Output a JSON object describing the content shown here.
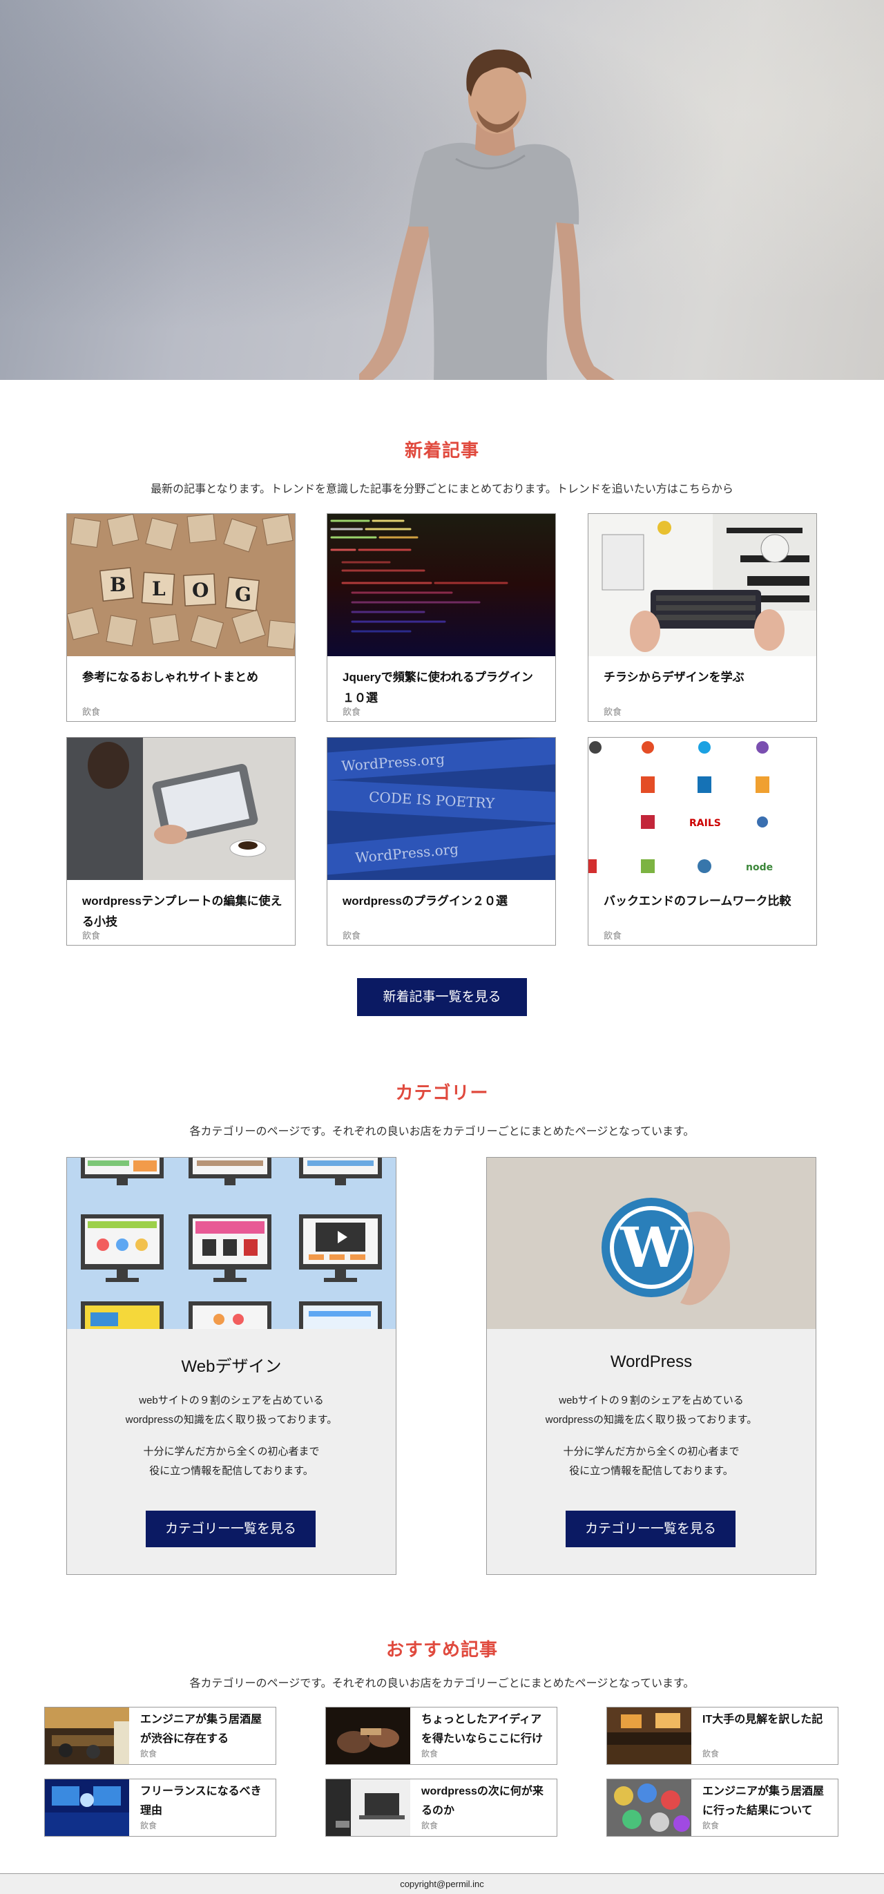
{
  "new_articles": {
    "title": "新着記事",
    "description": "最新の記事となります。トレンドを意識した記事を分野ごとにまとめております。トレンドを追いたい方はこちらから",
    "items": [
      {
        "title": "参考になるおしゃれサイトまとめ",
        "category": "飲食",
        "image": "blog-scrabble-tiles"
      },
      {
        "title": "Jqueryで頻繁に使われるプラグイン１０選",
        "category": "飲食",
        "image": "code-screen"
      },
      {
        "title": "チラシからデザインを学ぶ",
        "category": "飲食",
        "image": "keyboard-desk"
      },
      {
        "title": "wordpressテンプレートの編集に使える小技",
        "category": "飲食",
        "image": "tablet-coffee"
      },
      {
        "title": "wordpressのプラグイン２０選",
        "category": "飲食",
        "image": "wordpress-lanyard"
      },
      {
        "title": "バックエンドのフレームワーク比較",
        "category": "飲食",
        "image": "tech-logos"
      }
    ],
    "button_label": "新着記事一覧を見る"
  },
  "categories": {
    "title": "カテゴリー",
    "description": "各カテゴリーのページです。それぞれの良いお店をカテゴリーごとにまとめたページとなっています。",
    "items": [
      {
        "name": "Webデザイン",
        "text1_line1": "webサイトの９割のシェアを占めている",
        "text1_line2": "wordpressの知識を広く取り扱っております。",
        "text2_line1": "十分に学んだ方から全くの初心者まで",
        "text2_line2": "役に立つ情報を配信しております。",
        "button_label": "カテゴリー一覧を見る",
        "image": "monitors-illustration"
      },
      {
        "name": "WordPress",
        "text1_line1": "webサイトの９割のシェアを占めている",
        "text1_line2": "wordpressの知識を広く取り扱っております。",
        "text2_line1": "十分に学んだ方から全くの初心者まで",
        "text2_line2": "役に立つ情報を配信しております。",
        "button_label": "カテゴリー一覧を見る",
        "image": "wordpress-badge"
      }
    ]
  },
  "recommended": {
    "title": "おすすめ記事",
    "description": "各カテゴリーのページです。それぞれの良いお店をカテゴリーごとにまとめたページとなっています。",
    "items": [
      {
        "title": "エンジニアが集う居酒屋が渋谷に存在する",
        "category": "飲食"
      },
      {
        "title": "ちょっとしたアイディアを得たいならここに行け",
        "category": "飲食"
      },
      {
        "title": "IT大手の見解を訳した記",
        "category": "飲食"
      },
      {
        "title": "フリーランスになるべき理由",
        "category": "飲食"
      },
      {
        "title": "wordpressの次に何が来るのか",
        "category": "飲食"
      },
      {
        "title": "エンジニアが集う居酒屋に行った結果について",
        "category": "飲食"
      }
    ]
  },
  "footer": {
    "copyright": "copyright@permil.inc"
  },
  "colors": {
    "accent": "#e04a3e",
    "button": "#0b1a63",
    "card_bg": "#efefef",
    "border": "#9b9b9b"
  }
}
